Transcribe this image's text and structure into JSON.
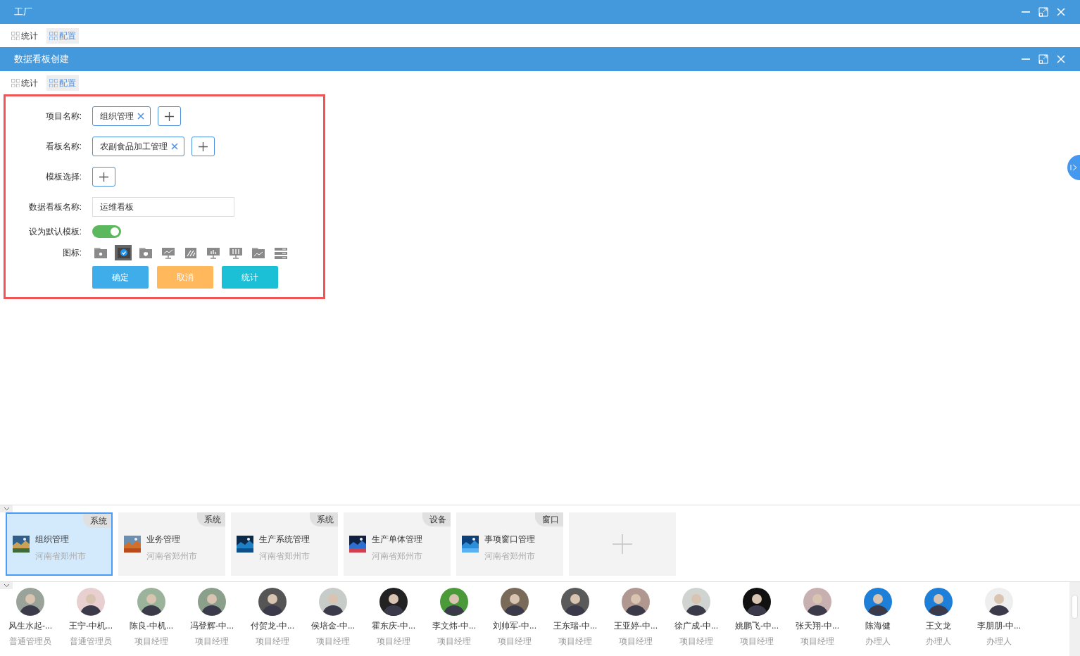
{
  "outer_window": {
    "title": "工厂",
    "tabs": [
      {
        "label": "统计",
        "selected": false
      },
      {
        "label": "配置",
        "selected": true
      }
    ]
  },
  "inner_window": {
    "title": "数据看板创建",
    "tabs": [
      {
        "label": "统计",
        "selected": false
      },
      {
        "label": "配置",
        "selected": true
      }
    ]
  },
  "form": {
    "project_name": {
      "label": "项目名称:",
      "tags": [
        "组织管理"
      ]
    },
    "board_name": {
      "label": "看板名称:",
      "tags": [
        "农副食品加工管理"
      ]
    },
    "template": {
      "label": "模板选择:"
    },
    "dashboard_name": {
      "label": "数据看板名称:",
      "value": "运维看板"
    },
    "default_template": {
      "label": "设为默认模板:",
      "on": true
    },
    "icons": {
      "label": "图标:",
      "items": [
        {
          "kind": "folder-gear",
          "selected": false
        },
        {
          "kind": "check",
          "selected": true
        },
        {
          "kind": "folder-shield",
          "selected": false
        },
        {
          "kind": "monitor-line",
          "selected": false
        },
        {
          "kind": "chip",
          "selected": false
        },
        {
          "kind": "monitor-bars",
          "selected": false
        },
        {
          "kind": "monitor-sliders",
          "selected": false
        },
        {
          "kind": "folder-chart",
          "selected": false
        },
        {
          "kind": "list",
          "selected": false
        }
      ]
    },
    "buttons": [
      {
        "label": "确定",
        "kind": "primary"
      },
      {
        "label": "取消",
        "kind": "warning"
      },
      {
        "label": "统计",
        "kind": "info"
      }
    ]
  },
  "project_panel": {
    "expanded": true
  },
  "people_panel": {
    "expanded": true
  },
  "projects": [
    {
      "kind": "project",
      "title": "组织管理",
      "location": "河南省郑州市",
      "tag": "系统",
      "selected": true
    },
    {
      "kind": "project",
      "title": "业务管理",
      "location": "河南省郑州市",
      "tag": "系统",
      "selected": false
    },
    {
      "kind": "project",
      "title": "生产系统管理",
      "location": "河南省郑州市",
      "tag": "系统",
      "selected": false
    },
    {
      "kind": "project",
      "title": "生产单体管理",
      "location": "河南省郑州市",
      "tag": "设备",
      "selected": false
    },
    {
      "kind": "project",
      "title": "事项窗口管理",
      "location": "河南省郑州市",
      "tag": "窗口",
      "selected": false
    },
    {
      "kind": "add",
      "selected": false
    }
  ],
  "people": [
    {
      "name": "风生水起-...",
      "role": "普通管理员"
    },
    {
      "name": "王宁-中机...",
      "role": "普通管理员"
    },
    {
      "name": "陈良-中机...",
      "role": "项目经理"
    },
    {
      "name": "冯登辉-中...",
      "role": "项目经理"
    },
    {
      "name": "付贺龙-中...",
      "role": "项目经理"
    },
    {
      "name": "侯培金-中...",
      "role": "项目经理"
    },
    {
      "name": "霍东庆-中...",
      "role": "项目经理"
    },
    {
      "name": "李文炜-中...",
      "role": "项目经理"
    },
    {
      "name": "刘帅军-中...",
      "role": "项目经理"
    },
    {
      "name": "王东瑞-中...",
      "role": "项目经理"
    },
    {
      "name": "王亚婷-中...",
      "role": "项目经理"
    },
    {
      "name": "徐广成-中...",
      "role": "项目经理"
    },
    {
      "name": "姚鹏飞-中...",
      "role": "项目经理"
    },
    {
      "name": "张天翔-中...",
      "role": "项目经理"
    },
    {
      "name": "陈海健",
      "role": "办理人"
    },
    {
      "name": "王文龙",
      "role": "办理人"
    },
    {
      "name": "李朋朋-中...",
      "role": "办理人"
    }
  ]
}
